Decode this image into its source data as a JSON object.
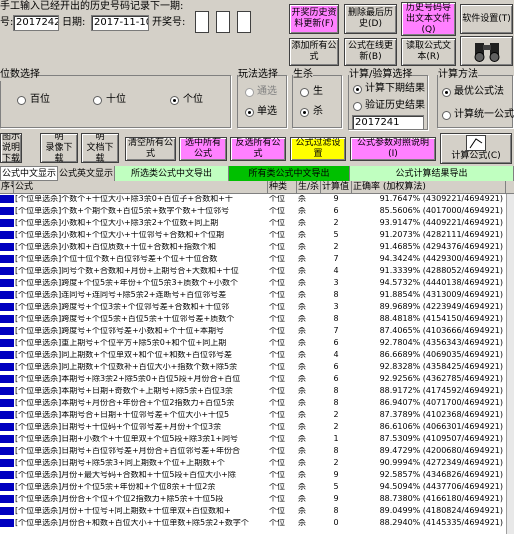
{
  "top": {
    "prompt_label": "手工输入已经开出的历史号码记录下一期:",
    "period_label": "号:",
    "period_value": "2017242",
    "date_label": "日期:",
    "date_value": "2017-11-10",
    "prize_label": "开奖号:"
  },
  "buttons": {
    "open_history": "开奖历史资\n料更新(F)",
    "delete_last": "删除最后历\n史(D)",
    "export_history": "历史号码导\n出文本文件\n(Q)",
    "settings": "软件设置(T)",
    "add_formula": "添加所有公\n式",
    "formula_online": "公式在线更\n新(B)",
    "read_formula": "读取公式文\n本(R)"
  },
  "groups": {
    "position": {
      "title": "位数选择",
      "options": [
        "百位",
        "十位",
        "个位"
      ],
      "selected": 2
    },
    "play": {
      "title": "玩法选择",
      "options": [
        "通选",
        "单选"
      ],
      "selected": 1
    },
    "life": {
      "title": "生杀",
      "options": [
        "生",
        "杀"
      ],
      "selected": 1
    },
    "calc": {
      "title": "计算/验算选择",
      "options": [
        "计算下期结果",
        "验证历史结果"
      ],
      "selected": 0,
      "input_value": "2017241"
    },
    "method": {
      "title": "计算方法",
      "options": [
        "最优公式法",
        "计算统一公式"
      ],
      "selected": 0
    }
  },
  "toolbar2": {
    "b1": "使用图示\n说明下载\n(P)",
    "b2": "演示说明\n录像下载\n(E)",
    "b3": "使用说明\n文档下载\n(Y)",
    "b4": "清空所有公\n式",
    "b5": "选中所有\n公式",
    "b6": "反选所有公\n式",
    "b7": "公式过滤设\n置",
    "b8": "公式参数对照说明\n(I)",
    "b9": "计算公式(C)"
  },
  "strip": {
    "tab1": "公式中文显示",
    "tab2": "公式英文显示",
    "exp1": "所选类公式中文导出",
    "exp2": "所有类公式中文导出",
    "exp3": "公式计算结果导出"
  },
  "grid": {
    "headers": [
      "序号",
      "公式",
      "种类",
      "生/杀",
      "计算值",
      "正确率 (加权算法)"
    ],
    "rows": [
      {
        "f": "[个位单选杀]个数个+十位大小+除3余0+百位子+合数和+十",
        "k": "个位",
        "s": "杀",
        "v": "9",
        "r": "91.7647% (4309221/4694921)"
      },
      {
        "f": "[个位单选杀]个数+个期个数+百位5余+数字个数+十位邻号",
        "k": "个位",
        "s": "杀",
        "v": "6",
        "r": "85.5606% (4017000/4694921)"
      },
      {
        "f": "[个位单选杀]小数和+个位大小+除3余2+个位数+同上期",
        "k": "个位",
        "s": "杀",
        "v": "2",
        "r": "93.9147% (4409221/4694921)"
      },
      {
        "f": "[个位单选杀]小数和+个位大小+十位邻号+合数和+个位期",
        "k": "个位",
        "s": "杀",
        "v": "5",
        "r": "91.2073% (4282111/4694921)"
      },
      {
        "f": "[个位单选杀]小数和+百位质数+十位+合数和+指数个和",
        "k": "个位",
        "s": "杀",
        "v": "2",
        "r": "91.4685% (4294376/4694921)"
      },
      {
        "f": "[个位单选杀]个位十位个数+百位邻号差+个位+十位合数",
        "k": "个位",
        "s": "杀",
        "v": "7",
        "r": "94.3424% (4429300/4694921)"
      },
      {
        "f": "[个位单选杀]同号个数+合数和+月份+上期号合+大数和+十位",
        "k": "个位",
        "s": "杀",
        "v": "4",
        "r": "91.3339% (4288052/4694921)"
      },
      {
        "f": "[个位单选杀]跨度+个位5余+年份+个位5余3+质数个+小数个",
        "k": "个位",
        "s": "杀",
        "v": "3",
        "r": "94.5732% (4440138/4694921)"
      },
      {
        "f": "[个位单选杀]连同号+连同号+除5余2+连断号+百位邻号差",
        "k": "个位",
        "s": "杀",
        "v": "8",
        "r": "91.8854% (4313009/4694921)"
      },
      {
        "f": "[个位单选杀]跨度号+个位3余+个位邻号差+合数和+十位邻",
        "k": "个位",
        "s": "杀",
        "v": "3",
        "r": "89.9689% (4223949/4694921)"
      },
      {
        "f": "[个位单选杀]跨度号+个位5余+百位5余+十位邻号差+质数个",
        "k": "个位",
        "s": "杀",
        "v": "8",
        "r": "88.4818% (4154150/4694921)"
      },
      {
        "f": "[个位单选杀]跨度号+个位邻号差+小数和+个十位+本期号",
        "k": "个位",
        "s": "杀",
        "v": "7",
        "r": "87.4065% (4103666/4694921)"
      },
      {
        "f": "[个位单选杀]重上期号+个位平方+除5余0+和个位+同上期",
        "k": "个位",
        "s": "杀",
        "v": "6",
        "r": "92.7804% (4356343/4694921)"
      },
      {
        "f": "[个位单选杀]同上期数+个位单双+和个位+和数+百位邻号差",
        "k": "个位",
        "s": "杀",
        "v": "4",
        "r": "86.6689% (4069035/4694921)"
      },
      {
        "f": "[个位单选杀]同上期数+个位数补+百位大小+指数个数+除5余",
        "k": "个位",
        "s": "杀",
        "v": "6",
        "r": "92.8328% (4358425/4694921)"
      },
      {
        "f": "[个位单选杀]本期号+除3余2+除5余0+百位5段+月份合+百位",
        "k": "个位",
        "s": "杀",
        "v": "6",
        "r": "92.9256% (4362785/4694921)"
      },
      {
        "f": "[个位单选杀]本期号+日期+奇数个+上期号+除5余+百位3余",
        "k": "个位",
        "s": "杀",
        "v": "8",
        "r": "88.9172% (4174592/4694921)"
      },
      {
        "f": "[个位单选杀]本期号+月份合+年份合+个位2指数力+百位5余",
        "k": "个位",
        "s": "杀",
        "v": "8",
        "r": "86.9407% (4071700/4694921)"
      },
      {
        "f": "[个位单选杀]本期号合+日期+十位邻号差+个位大小+十位5",
        "k": "个位",
        "s": "杀",
        "v": "2",
        "r": "87.3789% (4102368/4694921)"
      },
      {
        "f": "[个位单选杀]日期号+十位码+个位邻号差+月份+个位3余",
        "k": "个位",
        "s": "杀",
        "v": "2",
        "r": "86.6106% (4066301/4694921)"
      },
      {
        "f": "[个位单选杀]日期+小数个+十位单双+个位5段+除3余1+同号",
        "k": "个位",
        "s": "杀",
        "v": "1",
        "r": "87.5309% (4109507/4694921)"
      },
      {
        "f": "[个位单选杀]日期号+百位邻号差+月份合+百位邻号差+年份合",
        "k": "个位",
        "s": "杀",
        "v": "8",
        "r": "89.4729% (4200680/4694921)"
      },
      {
        "f": "[个位单选杀]日期号+除5余3+同上期数+个位+上期数+个",
        "k": "个位",
        "s": "杀",
        "v": "2",
        "r": "90.9994% (4272349/4694921)"
      },
      {
        "f": "[个位单选杀]月份+最大号码+合数和+十位5段+百位大小+除",
        "k": "个位",
        "s": "杀",
        "v": "9",
        "r": "92.5857% (4346826/4694921)"
      },
      {
        "f": "[个位单选杀]月份+个位5余+年份和+个位8余+十位2余",
        "k": "个位",
        "s": "杀",
        "v": "5",
        "r": "94.5094% (4437706/4694921)"
      },
      {
        "f": "[个位单选杀]月份合+个位+个位2指数力+除5余+十位5段",
        "k": "个位",
        "s": "杀",
        "v": "9",
        "r": "88.7380% (4166180/4694921)"
      },
      {
        "f": "[个位单选杀]月份+十位号+同上期数+十位单双+百位数和+",
        "k": "个位",
        "s": "杀",
        "v": "8",
        "r": "89.0499% (4180824/4694921)"
      },
      {
        "f": "[个位单选杀]月份合+和数+百位大小+十位单数+除5余2+数字个",
        "k": "个位",
        "s": "杀",
        "v": "0",
        "r": "88.2940% (4145335/4694921)"
      }
    ]
  }
}
